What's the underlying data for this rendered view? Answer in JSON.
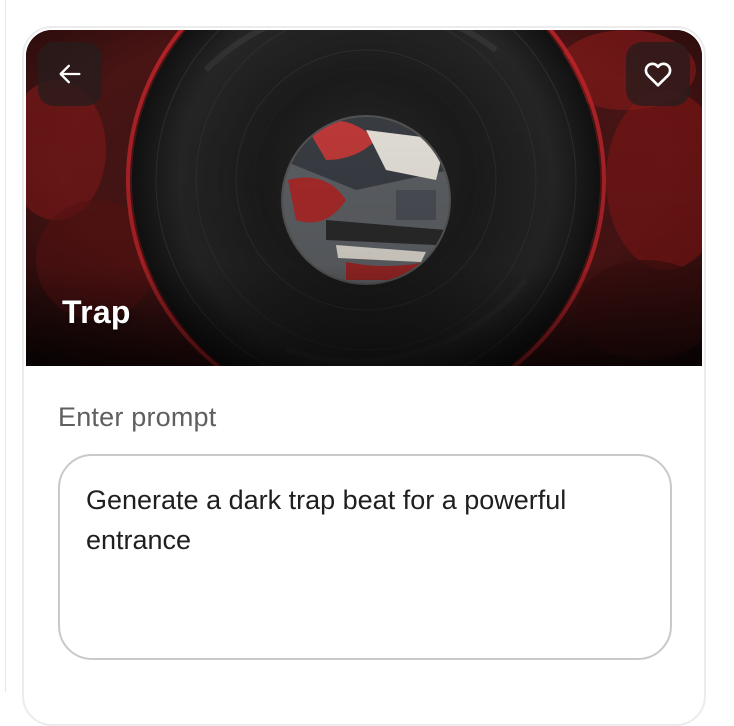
{
  "header": {
    "title": "Trap",
    "back_icon": "arrow-left-icon",
    "favorite_icon": "heart-outline-icon"
  },
  "prompt": {
    "label": "Enter prompt",
    "value": "Generate a dark trap beat for a powerful entrance"
  },
  "colors": {
    "accent_red": "#c0252a",
    "vinyl_black": "#141414",
    "text_primary": "#1f1f1f",
    "text_secondary": "#5f5f5f",
    "border": "#c9c9c9"
  }
}
